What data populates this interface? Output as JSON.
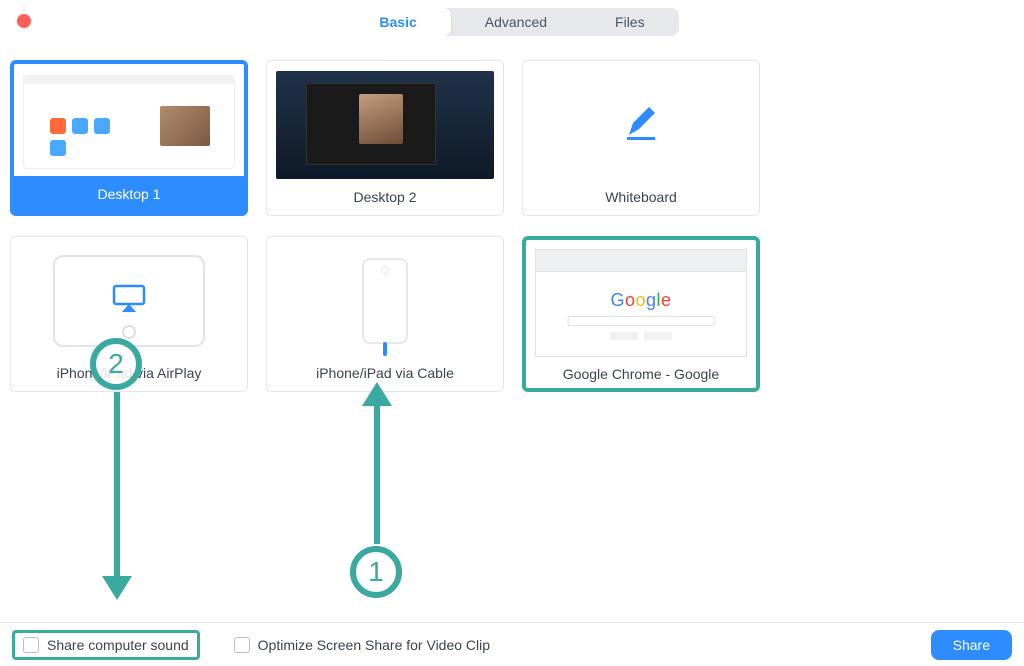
{
  "colors": {
    "accent": "#2d8cff",
    "highlight": "#3aa99f"
  },
  "tabs": {
    "basic": "Basic",
    "advanced": "Advanced",
    "files": "Files",
    "active": "basic"
  },
  "sources": {
    "desktop1": "Desktop 1",
    "desktop2": "Desktop 2",
    "whiteboard": "Whiteboard",
    "airplay": "iPhone/iPad via AirPlay",
    "cable": "iPhone/iPad via Cable",
    "chrome": "Google Chrome - Google"
  },
  "footer": {
    "share_sound": "Share computer sound",
    "optimize": "Optimize Screen Share for Video Clip",
    "share_button": "Share"
  },
  "annotations": {
    "step1": "1",
    "step2": "2"
  }
}
